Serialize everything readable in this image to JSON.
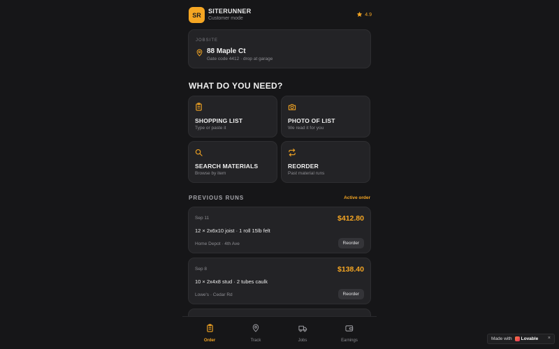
{
  "header": {
    "logo_initials": "SR",
    "brand_name": "SITERUNNER",
    "mode": "Customer mode",
    "rating": "4.9"
  },
  "jobsite": {
    "label": "JOBSITE",
    "address": "88 Maple Ct",
    "note": "Gate code 4412 · drop at garage"
  },
  "need": {
    "title": "WHAT DO YOU NEED?",
    "tiles": [
      {
        "icon": "clipboard-icon",
        "title": "SHOPPING LIST",
        "sub": "Type or paste it"
      },
      {
        "icon": "camera-icon",
        "title": "PHOTO OF LIST",
        "sub": "We read it for you"
      },
      {
        "icon": "search-icon",
        "title": "SEARCH MATERIALS",
        "sub": "Browse by item"
      },
      {
        "icon": "repeat-icon",
        "title": "REORDER",
        "sub": "Past material runs"
      }
    ]
  },
  "runs": {
    "title": "PREVIOUS RUNS",
    "active_link": "Active order",
    "items": [
      {
        "date": "Sep 11",
        "price": "$412.80",
        "items": "12 × 2x6x10 joist · 1 roll 15lb felt",
        "store": "Home Depot · 4th Ave",
        "button": "Reorder"
      },
      {
        "date": "Sep 8",
        "price": "$138.40",
        "items": "10 × 2x4x8 stud · 2 tubes caulk",
        "store": "Lowe's · Cedar Rd",
        "button": "Reorder"
      }
    ]
  },
  "nav": {
    "order": "Order",
    "track": "Track",
    "jobs": "Jobs",
    "earnings": "Earnings",
    "active": "Order"
  },
  "badge": {
    "prefix": "Made with",
    "name": "Lovable",
    "close": "×"
  },
  "colors": {
    "accent": "#f5a623",
    "background": "#161618",
    "card": "#232326"
  }
}
